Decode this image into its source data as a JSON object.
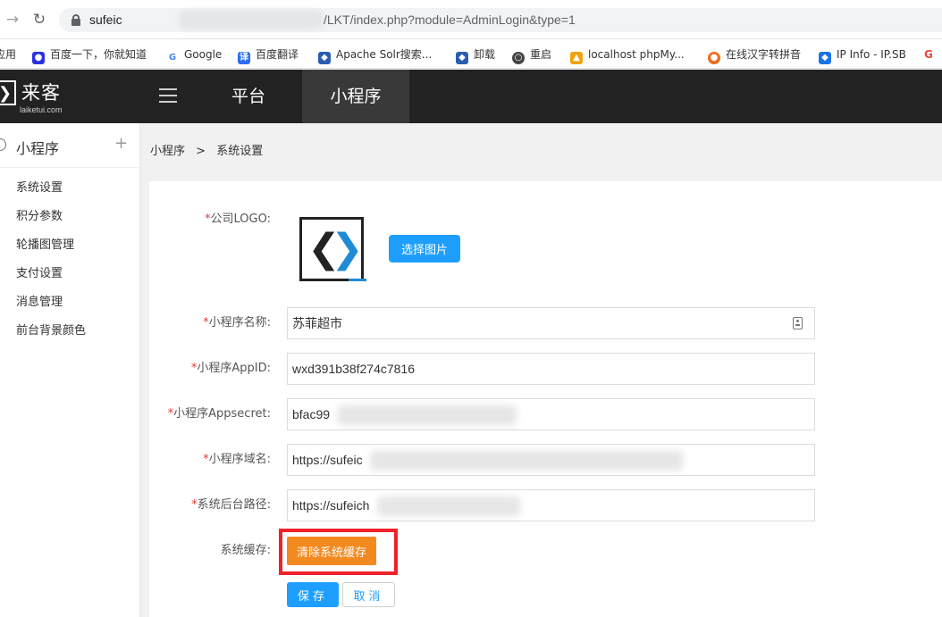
{
  "browser": {
    "url_host_visible": "sufeic",
    "url_path": "/LKT/index.php?module=AdminLogin&type=1",
    "bookmarks": [
      {
        "label": "应用",
        "icon": "apps-icon",
        "color": "#4285f4"
      },
      {
        "label": "百度一下，你就知道",
        "icon": "baidu-paw-icon",
        "color": "#2932e1"
      },
      {
        "label": "Google",
        "icon": "google-icon",
        "color": "#4285f4"
      },
      {
        "label": "百度翻译",
        "icon": "baidu-translate-icon",
        "color": "#2c6df0"
      },
      {
        "label": "Apache Solr搜索...",
        "icon": "solr-icon",
        "color": "#2a5db0"
      },
      {
        "label": "卸载",
        "icon": "uninstall-icon",
        "color": "#2a5db0"
      },
      {
        "label": "重启",
        "icon": "globe-icon",
        "color": "#444444"
      },
      {
        "label": "localhost phpMy...",
        "icon": "phpmyadmin-icon",
        "color": "#f0a30a"
      },
      {
        "label": "在线汉字转拼音",
        "icon": "pinyin-icon",
        "color": "#f06a1d"
      },
      {
        "label": "IP Info - IP.SB",
        "icon": "ipsb-icon",
        "color": "#1a73e8"
      },
      {
        "label": "G",
        "icon": "google-icon",
        "color": "#ea4335"
      }
    ]
  },
  "header": {
    "logo_name": "来客",
    "logo_domain": "laiketui.com",
    "tabs": [
      "平台",
      "小程序"
    ]
  },
  "sidebar": {
    "title": "小程序",
    "plus": "+",
    "items": [
      "系统设置",
      "积分参数",
      "轮播图管理",
      "支付设置",
      "消息管理",
      "前台背景颜色"
    ]
  },
  "breadcrumb": {
    "parent": "小程序",
    "separator": ">",
    "current": "系统设置"
  },
  "form": {
    "logo_label": "公司LOGO:",
    "choose_image": "选择图片",
    "name_label": "小程序名称:",
    "name_value": "苏菲超市",
    "appid_label": "小程序AppID:",
    "appid_value": "wxd391b38f274c7816",
    "secret_label": "小程序Appsecret:",
    "secret_value": "bfac99",
    "domain_label": "小程序域名:",
    "domain_value": "https://sufeic",
    "backend_label": "系统后台路径:",
    "backend_value": "https://sufeich",
    "cache_label": "系统缓存:",
    "clear_cache": "清除系统缓存",
    "save": "保存",
    "cancel": "取消",
    "required_mark": "*"
  }
}
